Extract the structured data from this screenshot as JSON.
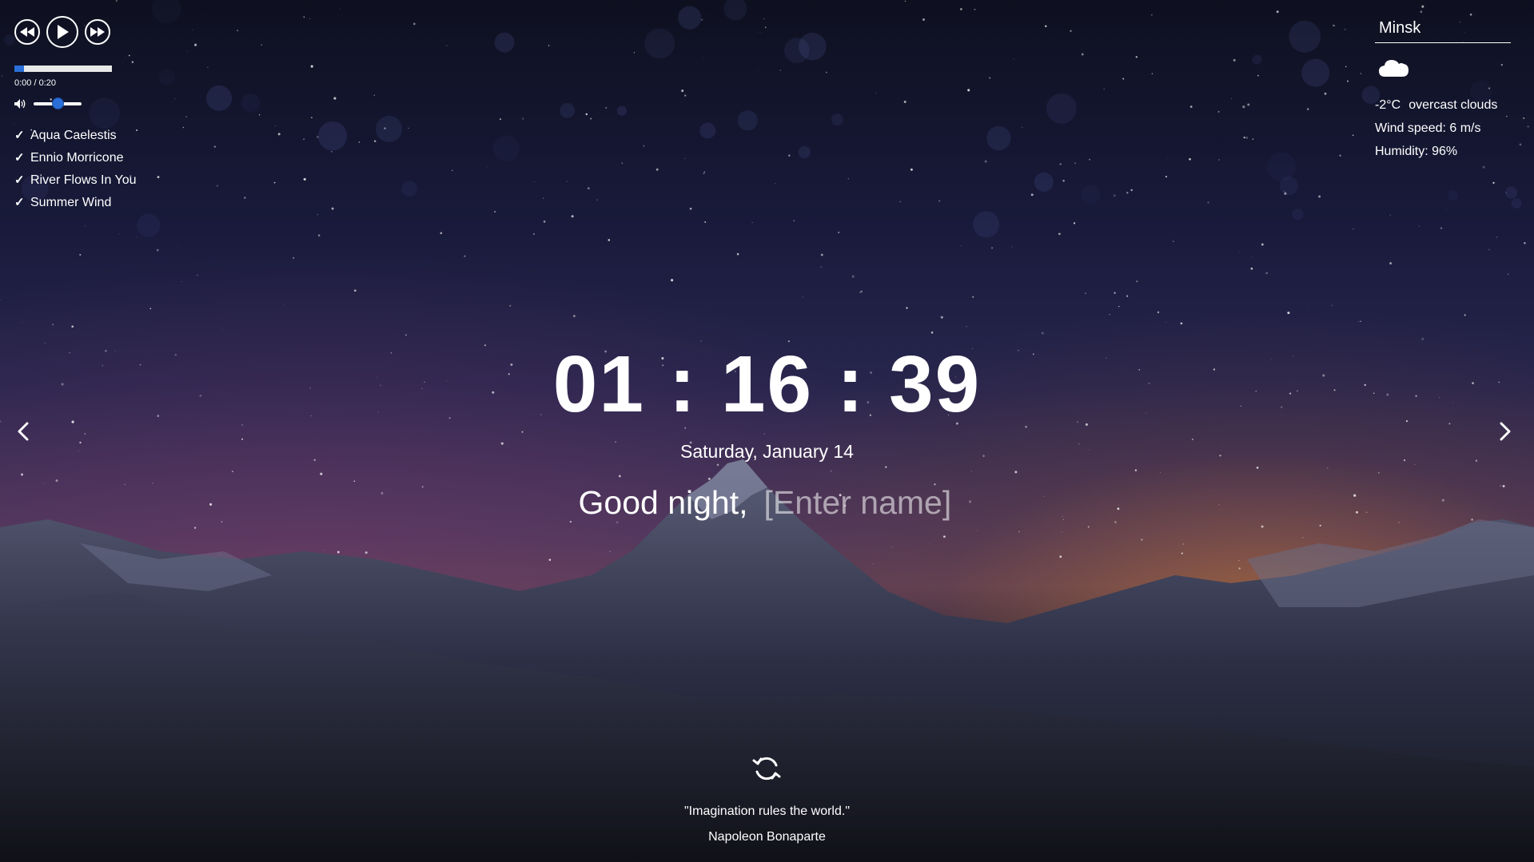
{
  "player": {
    "prev_icon": "rewind-icon",
    "play_icon": "play-icon",
    "next_icon": "fast-forward-icon",
    "progress": 0.1,
    "time": "0:00 / 0:20",
    "volume": 0.5,
    "volume_icon": "speaker-icon",
    "playlist": [
      {
        "title": "Aqua Caelestis"
      },
      {
        "title": "Ennio Morricone"
      },
      {
        "title": "River Flows In You"
      },
      {
        "title": "Summer Wind"
      }
    ],
    "accent_color": "#2a6fd8"
  },
  "weather": {
    "city": "Minsk",
    "icon": "cloud-icon",
    "temperature": "-2°C",
    "description": "overcast clouds",
    "wind": "Wind speed: 6 m/s",
    "humidity": "Humidity: 96%"
  },
  "clock": {
    "time": "01:16:39",
    "date": "Saturday, January 14"
  },
  "greeting": {
    "text": "Good night,",
    "name_placeholder": "[Enter name]",
    "name_value": ""
  },
  "slider": {
    "prev_icon": "chevron-left-icon",
    "next_icon": "chevron-right-icon"
  },
  "quote": {
    "refresh_icon": "refresh-icon",
    "text": "\"Imagination rules the world.\"",
    "author": "Napoleon Bonaparte"
  }
}
